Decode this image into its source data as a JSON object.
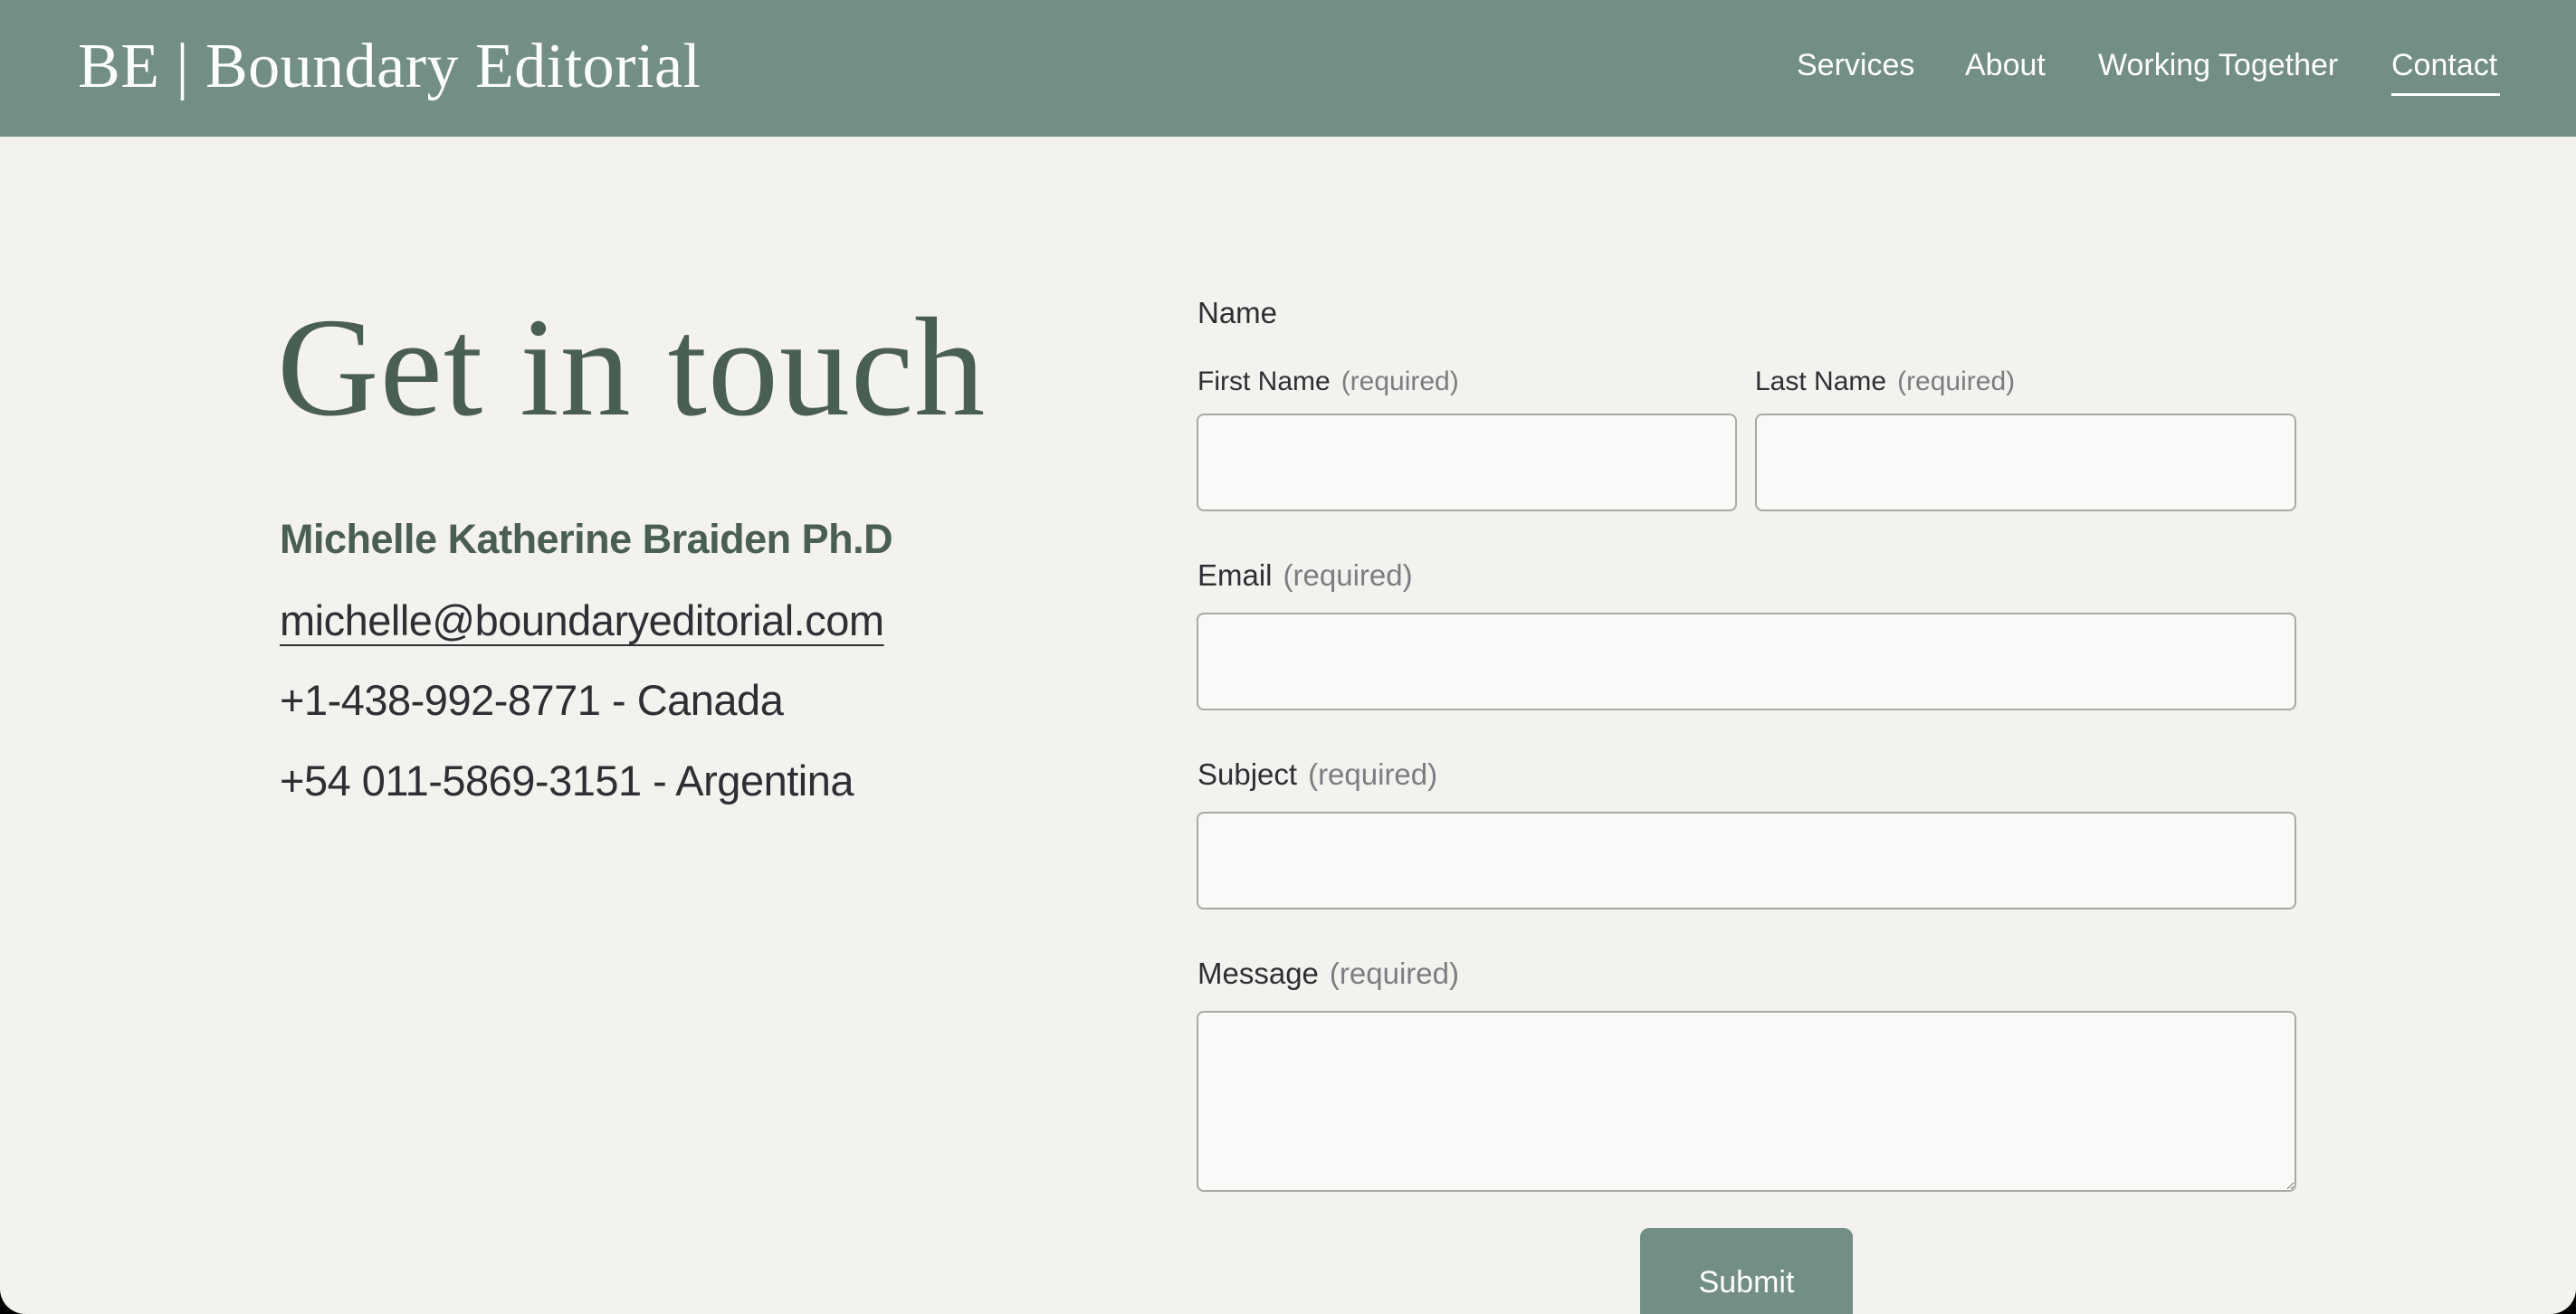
{
  "header": {
    "logo": "BE | Boundary Editorial",
    "nav": [
      {
        "label": "Services"
      },
      {
        "label": "About"
      },
      {
        "label": "Working Together"
      },
      {
        "label": "Contact",
        "active": true
      }
    ]
  },
  "contact": {
    "heading": "Get in touch",
    "name": "Michelle Katherine Braiden Ph.D",
    "email": "michelle@boundaryeditorial.com",
    "phones": [
      "+1-438-992-8771 - Canada",
      "+54 011-5869-3151 - Argentina"
    ]
  },
  "form": {
    "name_label": "Name",
    "first_name_label": "First Name",
    "last_name_label": "Last Name",
    "email_label": "Email",
    "subject_label": "Subject",
    "message_label": "Message",
    "required_text": "(required)",
    "first_name_value": "",
    "last_name_value": "",
    "email_value": "",
    "subject_value": "",
    "message_value": "",
    "submit_label": "Submit"
  },
  "colors": {
    "header_bg": "#728e85",
    "page_bg": "#f3f2ee",
    "heading_green": "#4a5f53",
    "button_bg": "#728e85"
  }
}
